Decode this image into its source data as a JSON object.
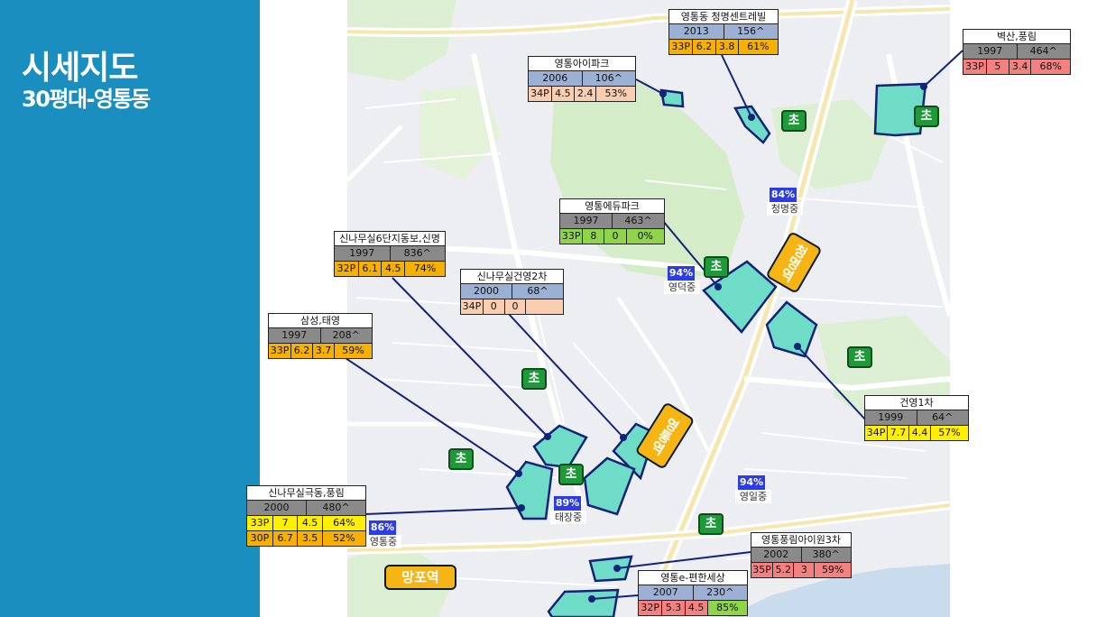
{
  "title": "시세지도",
  "subtitle": "30평대-영통동",
  "colors": {
    "sidebar": "#1a8ebf",
    "yellow": "#ffef00",
    "orange": "#f6b000",
    "peach": "#f8cdb0",
    "green": "#8fd44a",
    "red": "#f58080",
    "meta_gray": "#8a8a8a",
    "meta_blue": "#9cb0d3",
    "complex_fill": "#6fdcc8",
    "line": "#14237a",
    "school_badge": "#1f9a3a",
    "station": "#f6b513",
    "middle_pct": "#2b3ce8"
  },
  "cards": [
    {
      "id": "cheongmyeong-central",
      "name": "영통동 청명센트레빌",
      "year": "2013",
      "households": "156^",
      "meta_color": "blue",
      "size": "33P",
      "price": "6.2",
      "jeonse": "3.8",
      "ratio": "61%",
      "color": "orange"
    },
    {
      "id": "byeoksan-pungrim",
      "name": "벽산,풍림",
      "year": "1997",
      "households": "464^",
      "meta_color": "gray",
      "size": "33P",
      "price": "5",
      "jeonse": "3.4",
      "ratio": "68%",
      "color": "red"
    },
    {
      "id": "yeongtong-ipark",
      "name": "영통아이파크",
      "year": "2006",
      "households": "106^",
      "meta_color": "blue",
      "size": "34P",
      "price": "4.5",
      "jeonse": "2.4",
      "ratio": "53%",
      "color": "peach"
    },
    {
      "id": "edupark",
      "name": "영통에듀파크",
      "year": "1997",
      "households": "463^",
      "meta_color": "gray",
      "size": "33P",
      "price": "8",
      "jeonse": "0",
      "ratio": "0%",
      "color": "green"
    },
    {
      "id": "sinnamusil-6",
      "name": "신나무실6단지동보,신명",
      "year": "1997",
      "households": "836^",
      "meta_color": "gray",
      "size": "32P",
      "price": "6.1",
      "jeonse": "4.5",
      "ratio": "74%",
      "color": "orange"
    },
    {
      "id": "sinnamusil-geonyoung2",
      "name": "신나무실건영2차",
      "year": "2000",
      "households": "68^",
      "meta_color": "blue",
      "size": "34P",
      "price": "0",
      "jeonse": "0",
      "ratio": "",
      "color": "peach"
    },
    {
      "id": "samsung-taeyoung",
      "name": "삼성,태영",
      "year": "1997",
      "households": "208^",
      "meta_color": "gray",
      "size": "33P",
      "price": "6.2",
      "jeonse": "3.7",
      "ratio": "59%",
      "color": "orange"
    },
    {
      "id": "geonyoung1",
      "name": "건영1차",
      "year": "1999",
      "households": "64^",
      "meta_color": "gray",
      "size": "34P",
      "price": "7.7",
      "jeonse": "4.4",
      "ratio": "57%",
      "color": "yellow"
    },
    {
      "id": "pungrim-ivill3",
      "name": "영통풍림아이원3차",
      "year": "2002",
      "households": "380^",
      "meta_color": "gray",
      "size": "35P",
      "price": "5.2",
      "jeonse": "3",
      "ratio": "59%",
      "color": "red"
    },
    {
      "id": "e-pyeonhan",
      "name": "영통e-편한세상",
      "year": "2007",
      "households": "230^",
      "meta_color": "blue",
      "size": "32P",
      "price": "5.3",
      "jeonse": "4.5",
      "ratio": "85%",
      "color": "red",
      "ratio_color": "green"
    }
  ],
  "card_multi": {
    "id": "sinnamusil-geukdong",
    "name": "신나무실극동,풍림",
    "year": "2000",
    "households": "480^",
    "rows": [
      {
        "size": "33P",
        "price": "7",
        "jeonse": "4.5",
        "ratio": "64%",
        "color": "yellow"
      },
      {
        "size": "30P",
        "price": "6.7",
        "jeonse": "3.5",
        "ratio": "52%",
        "color": "orange"
      }
    ]
  },
  "school_badges": [
    "초",
    "초",
    "초",
    "초",
    "초",
    "초",
    "초"
  ],
  "stations": {
    "cheongmyeong": "청명역",
    "yeongtong": "영통역",
    "mangpo": "망포역"
  },
  "middle_schools": [
    {
      "id": "cheongmyeong-mid",
      "pct": "84%",
      "name": "청명중"
    },
    {
      "id": "yeongdeok-mid",
      "pct": "94%",
      "name": "영덕중"
    },
    {
      "id": "taejang-mid",
      "pct": "89%",
      "name": "태장중"
    },
    {
      "id": "yeongil-mid",
      "pct": "94%",
      "name": "영일중"
    },
    {
      "id": "yeongtong-mid",
      "pct": "86%",
      "name": "영통중"
    }
  ]
}
